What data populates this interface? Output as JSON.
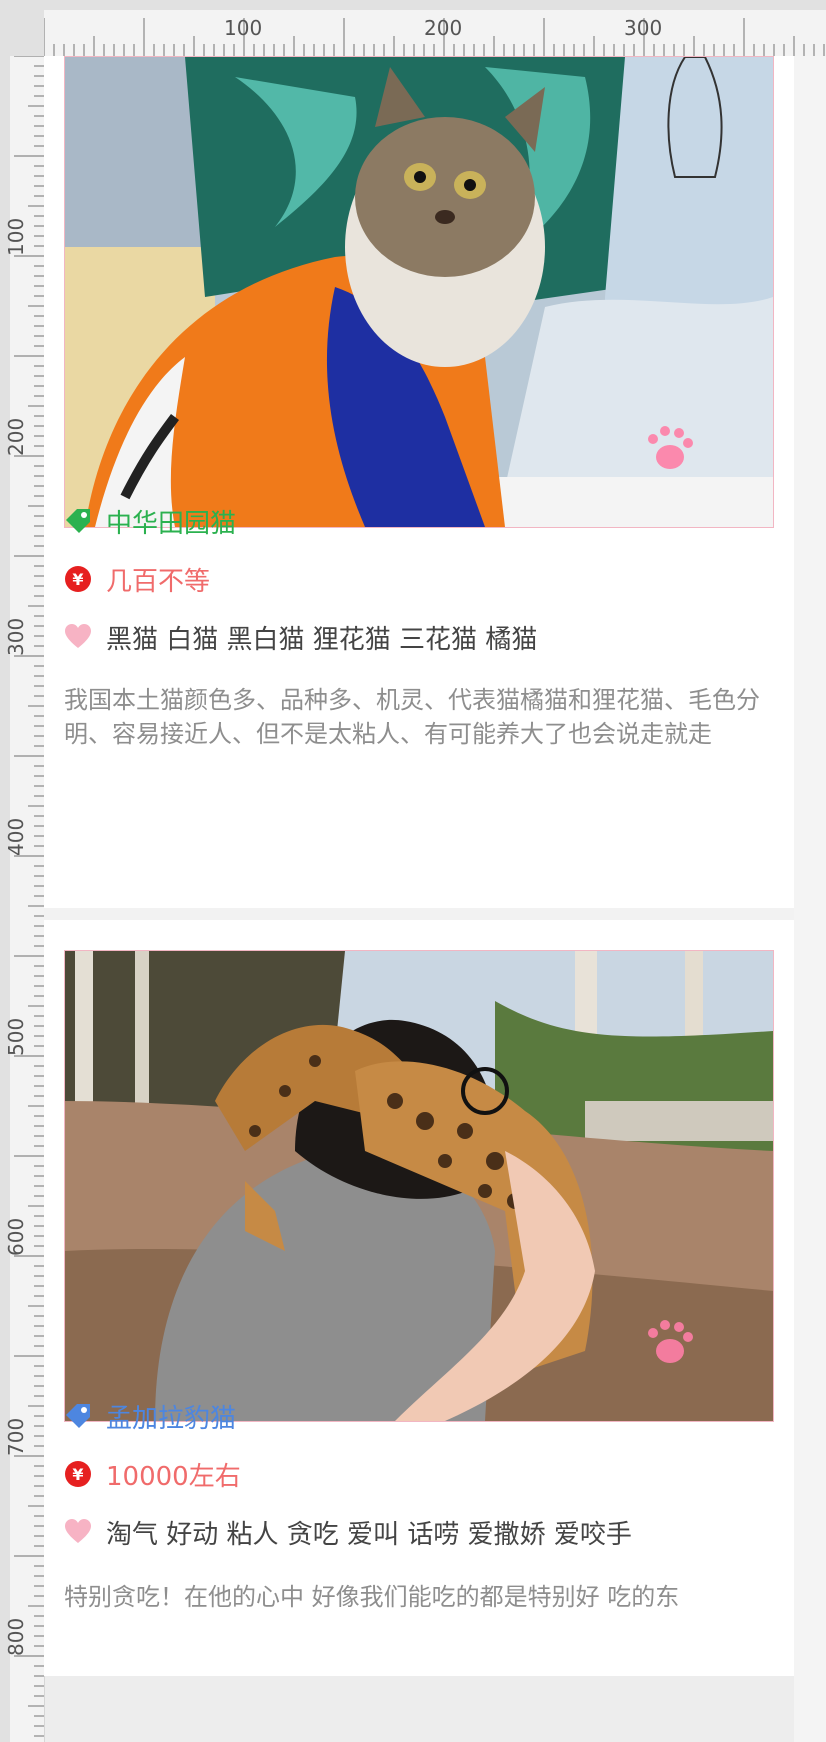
{
  "ruler": {
    "top_labels": [
      "100",
      "200",
      "300"
    ],
    "left_labels": [
      "100",
      "200",
      "300",
      "400",
      "500",
      "600",
      "700",
      "800"
    ]
  },
  "cards": [
    {
      "image_icon": "cat-in-costume-photo",
      "breed": "中华田园猫",
      "breed_color": "#2bb14f",
      "price": "几百不等",
      "traits": "黑猫 白猫 黑白猫 狸花猫 三花猫 橘猫",
      "description": "我国本土猫颜色多、品种多、机灵、代表猫橘猫和狸花猫、毛色分明、容易接近人、但不是太粘人、有可能养大了也会说走就走"
    },
    {
      "image_icon": "bengal-cat-hugging-photo",
      "breed": "孟加拉豹猫",
      "breed_color": "#4d86e0",
      "price": "10000左右",
      "traits": "淘气 好动 粘人 贪吃 爱叫 话唠 爱撒娇 爱咬手",
      "description": "特别贪吃！在他的心中 好像我们能吃的都是特别好 吃的东"
    }
  ],
  "icons": {
    "tag": "tag-icon",
    "price": "yen-icon",
    "traits": "heart-icon",
    "watermark": "paw-icon"
  },
  "colors": {
    "price_icon": "#e62020",
    "heart": "#f7b3c4",
    "accent_border": "#f2b6c3"
  }
}
